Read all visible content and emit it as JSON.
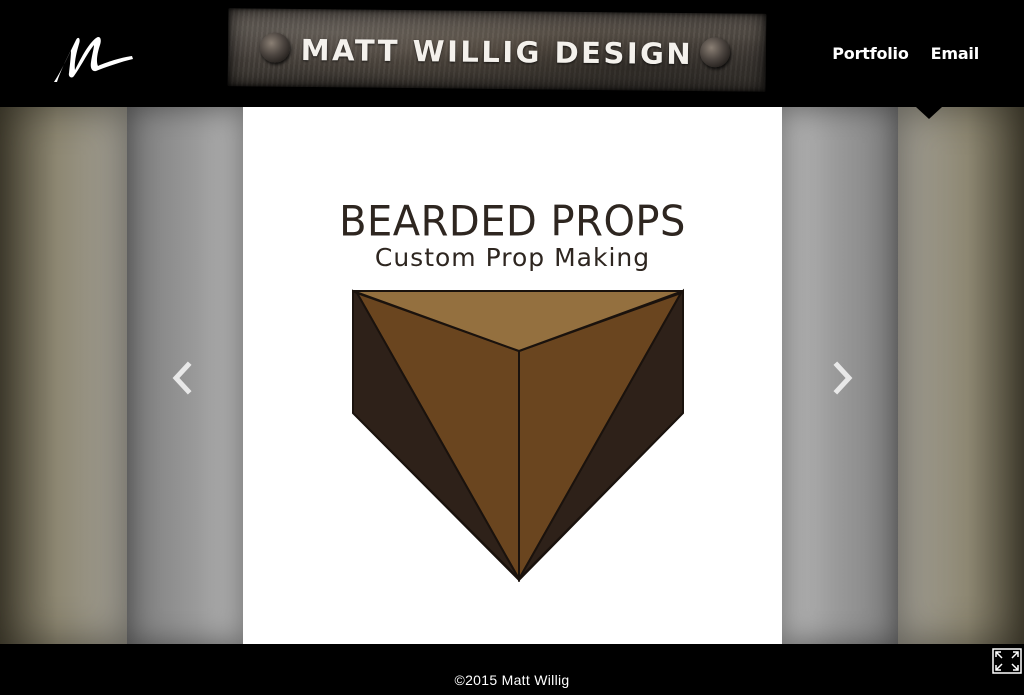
{
  "header": {
    "site_title": "MATT WILLIG DESIGN",
    "logo_icon": "handwritten-m-logo-icon",
    "nav": {
      "portfolio": "Portfolio",
      "email": "Email"
    }
  },
  "slideshow": {
    "current_slide": {
      "title": "BEARDED PROPS",
      "subtitle": "Custom Prop Making",
      "graphic": "brown-faceted-gem-icon"
    },
    "prev_icon": "chevron-left-icon",
    "next_icon": "chevron-right-icon"
  },
  "footer": {
    "copyright": "©2015 Matt Willig",
    "fullscreen_icon": "fullscreen-expand-icon"
  },
  "colors": {
    "background": "#000000",
    "slide_bg": "#ffffff",
    "title_text": "#2e2620",
    "gem_top": "#94703f",
    "gem_front": "#6a451f",
    "gem_side": "#2e2119"
  }
}
